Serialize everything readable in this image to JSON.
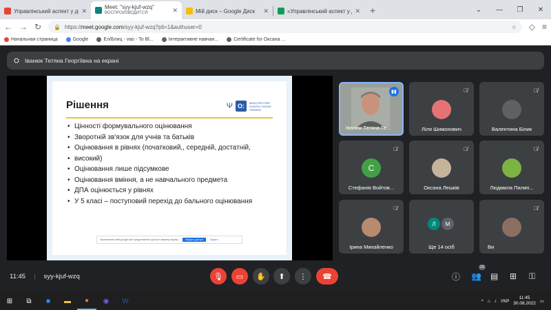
{
  "browser": {
    "tabs": [
      {
        "title": "Управлінський аспект у діяль",
        "subtitle": "",
        "favicon_color": "#e94235"
      },
      {
        "title": "Meet: \"syy-kjuf-wzq\"",
        "subtitle": "ВОСПРОИЗВОДИТСЯ",
        "favicon_color": "#00897b"
      },
      {
        "title": "Мій диск – Google Диск",
        "subtitle": "",
        "favicon_color": "#fbbc04"
      },
      {
        "title": "«Управлінський аспект у діяль",
        "subtitle": "",
        "favicon_color": "#0f9d58"
      }
    ],
    "new_tab": "+",
    "url_prefix": "https://",
    "url_host": "meet.google.com",
    "url_path": "/syy-kjuf-wzq?pli=1&authuser=0",
    "bookmarks": [
      {
        "label": "Начальная страница",
        "color": "#e94235"
      },
      {
        "label": "Google",
        "color": "#4285f4"
      },
      {
        "label": "Ел/Блиц - vao - To Bl...",
        "color": "#5f6368"
      },
      {
        "label": "Інтерактивне навчан...",
        "color": "#5f6368"
      },
      {
        "label": "Certificate for Оксана ...",
        "color": "#5f6368"
      }
    ]
  },
  "meet": {
    "presenter_label": "Іванюк Тетяна Георгіївна на екрані",
    "meeting_code": "syy-kjuf-wzq",
    "time": "11:45",
    "people_count": "23",
    "slide": {
      "title": "Рішення",
      "logo_text": "МІНІСТЕРСТВО ОСВІТИ І НАУКИ УКРАЇНИ",
      "bullets": [
        "Цінності формувального оцінювання",
        "Зворотній зв'язок для учнів та батьків",
        "Оцінювання в рівнях (початковий,, середній, достатній,",
        "високий)",
        "Оцінювання лише підсумкове",
        "Оцінювання вміння, а не навчального предмета",
        "ДПА оцінюється у рівнях",
        "У 5 класі – поступовий перехід до бального оцінювання"
      ],
      "share_notice": "Приложение meet.google.com предоставляет доступ к вашему экрану.",
      "share_stop": "Закрыть доступ",
      "share_hide": "Скрыть"
    },
    "participants": [
      {
        "name": "Іванюк Тетяна Ге...",
        "type": "video",
        "color": "#9a9f9a"
      },
      {
        "name": "Ліля Шимонович",
        "type": "photo",
        "color": "#e57373"
      },
      {
        "name": "Валентина Білик",
        "type": "photo",
        "color": "#616161"
      },
      {
        "name": "Стефанія Войтов...",
        "type": "letter",
        "letter": "С",
        "color": "#43a047"
      },
      {
        "name": "Оксана Лешків",
        "type": "photo",
        "color": "#c5b39a"
      },
      {
        "name": "Людмила Пилип...",
        "type": "photo",
        "color": "#7cb342"
      },
      {
        "name": "Ірина Михайленко",
        "type": "photo",
        "color": "#b88a6e"
      },
      {
        "name": "Ще 14 осіб",
        "type": "multi",
        "letters": [
          "Л",
          "М"
        ],
        "colors": [
          "#00897b",
          "#5f6368"
        ]
      },
      {
        "name": "Ви",
        "type": "photo",
        "color": "#8d6e63"
      }
    ]
  },
  "taskbar": {
    "lang": "УКР",
    "clock_time": "11:45",
    "clock_date": "30.08.2022"
  }
}
